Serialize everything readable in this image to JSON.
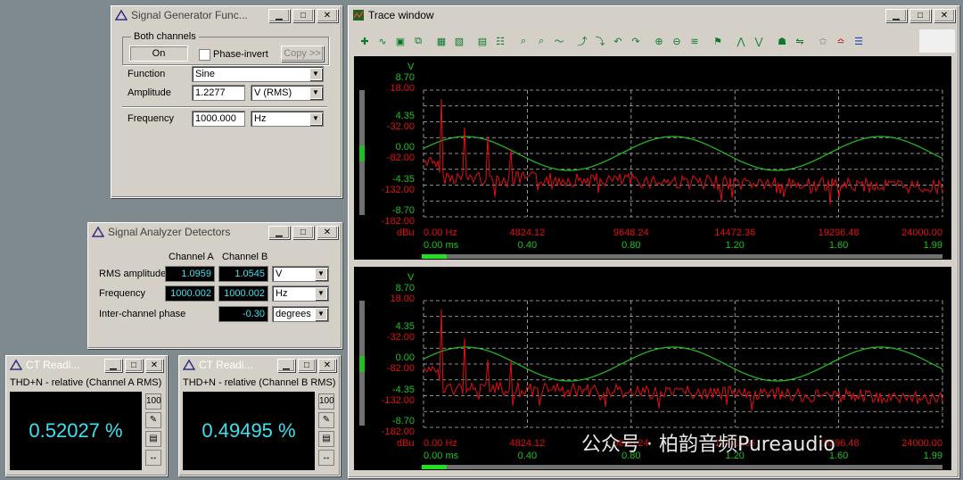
{
  "siggen": {
    "title": "Signal Generator Func...",
    "group_label": "Both channels",
    "on_label": "On",
    "phase_invert_label": "Phase-invert",
    "copy_label": "Copy >>",
    "function_label": "Function",
    "function_value": "Sine",
    "amplitude_label": "Amplitude",
    "amplitude_value": "1.2277",
    "amplitude_unit": "V (RMS)",
    "frequency_label": "Frequency",
    "frequency_value": "1000.000",
    "frequency_unit": "Hz"
  },
  "analyzer": {
    "title": "Signal Analyzer Detectors",
    "col_a": "Channel A",
    "col_b": "Channel B",
    "rms_label": "RMS amplitude",
    "rms_a": "1.0959",
    "rms_b": "1.0545",
    "rms_unit": "V",
    "freq_label": "Frequency",
    "freq_a": "1000.002",
    "freq_b": "1000.002",
    "freq_unit": "Hz",
    "phase_label": "Inter-channel phase",
    "phase_value": "-0.30",
    "phase_unit": "degrees"
  },
  "ct_a": {
    "title": "CT Readi...",
    "desc": "THD+N - relative (Channel A RMS)",
    "value": "0.52027 %"
  },
  "ct_b": {
    "title": "CT Readi...",
    "desc": "THD+N - relative (Channel B RMS)",
    "value": "0.49495 %"
  },
  "trace": {
    "title": "Trace window",
    "left_axis_unit_top": "V",
    "left_axis_unit_bottom": "dBu",
    "y_green": [
      "8.70",
      "4.35",
      "0.00",
      "-4.35",
      "-8.70"
    ],
    "y_red": [
      "18.00",
      "-32.00",
      "-82.00",
      "-132.00",
      "-182.00"
    ],
    "x_hz": [
      "0.00 Hz",
      "4824.12",
      "9648.24",
      "14472.36",
      "19296.48",
      "24000.00"
    ],
    "x_ms": [
      "0.00 ms",
      "0.40",
      "0.80",
      "1.20",
      "1.60",
      "1.99"
    ]
  },
  "watermark": "公众号 · 柏韵音频Pureaudio",
  "colors": {
    "green_trace": "#20c020",
    "red_trace": "#e01010",
    "readout": "#3fe0f0"
  }
}
